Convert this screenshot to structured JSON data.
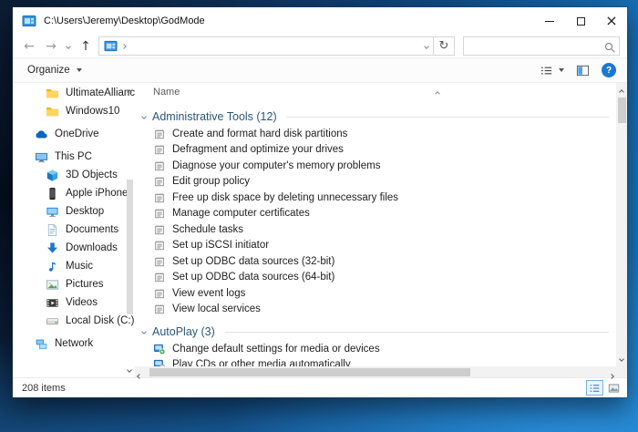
{
  "window": {
    "title": "C:\\Users\\Jeremy\\Desktop\\GodMode"
  },
  "toolbar": {
    "organize_label": "Organize"
  },
  "sidebar": {
    "items": [
      {
        "label": "UltimateAlliance",
        "icon": "folder",
        "indent": 2,
        "gap": false
      },
      {
        "label": "Windows10",
        "icon": "folder",
        "indent": 2,
        "gap": false
      },
      {
        "label": "OneDrive",
        "icon": "cloud",
        "indent": 1,
        "gap": true
      },
      {
        "label": "This PC",
        "icon": "pc",
        "indent": 1,
        "gap": true
      },
      {
        "label": "3D Objects",
        "icon": "cube",
        "indent": 2,
        "gap": false
      },
      {
        "label": "Apple iPhone",
        "icon": "phone",
        "indent": 2,
        "gap": false
      },
      {
        "label": "Desktop",
        "icon": "desktop",
        "indent": 2,
        "gap": false
      },
      {
        "label": "Documents",
        "icon": "document",
        "indent": 2,
        "gap": false
      },
      {
        "label": "Downloads",
        "icon": "download",
        "indent": 2,
        "gap": false
      },
      {
        "label": "Music",
        "icon": "music",
        "indent": 2,
        "gap": false
      },
      {
        "label": "Pictures",
        "icon": "picture",
        "indent": 2,
        "gap": false
      },
      {
        "label": "Videos",
        "icon": "video",
        "indent": 2,
        "gap": false
      },
      {
        "label": "Local Disk (C:)",
        "icon": "disk",
        "indent": 2,
        "gap": false
      },
      {
        "label": "Network",
        "icon": "network",
        "indent": 1,
        "gap": true
      }
    ]
  },
  "main": {
    "column_header": "Name",
    "groups": [
      {
        "label": "Administrative Tools",
        "count": 12,
        "items": [
          {
            "label": "Create and format hard disk partitions",
            "icon": "admin"
          },
          {
            "label": "Defragment and optimize your drives",
            "icon": "admin"
          },
          {
            "label": "Diagnose your computer's memory problems",
            "icon": "admin"
          },
          {
            "label": "Edit group policy",
            "icon": "admin"
          },
          {
            "label": "Free up disk space by deleting unnecessary files",
            "icon": "admin"
          },
          {
            "label": "Manage computer certificates",
            "icon": "admin"
          },
          {
            "label": "Schedule tasks",
            "icon": "admin"
          },
          {
            "label": "Set up iSCSI initiator",
            "icon": "admin"
          },
          {
            "label": "Set up ODBC data sources (32-bit)",
            "icon": "admin"
          },
          {
            "label": "Set up ODBC data sources (64-bit)",
            "icon": "admin"
          },
          {
            "label": "View event logs",
            "icon": "admin"
          },
          {
            "label": "View local services",
            "icon": "admin"
          }
        ]
      },
      {
        "label": "AutoPlay",
        "count": 3,
        "items": [
          {
            "label": "Change default settings for media or devices",
            "icon": "autoplay-settings"
          },
          {
            "label": "Play CDs or other media automatically",
            "icon": "autoplay-play"
          }
        ]
      }
    ]
  },
  "statusbar": {
    "items_text": "208 items"
  },
  "colors": {
    "accent": "#0078d7",
    "group_header_text": "#2b5777",
    "folder_yellow": "#ffd463",
    "scrollbar_thumb": "#cdcdcd"
  }
}
